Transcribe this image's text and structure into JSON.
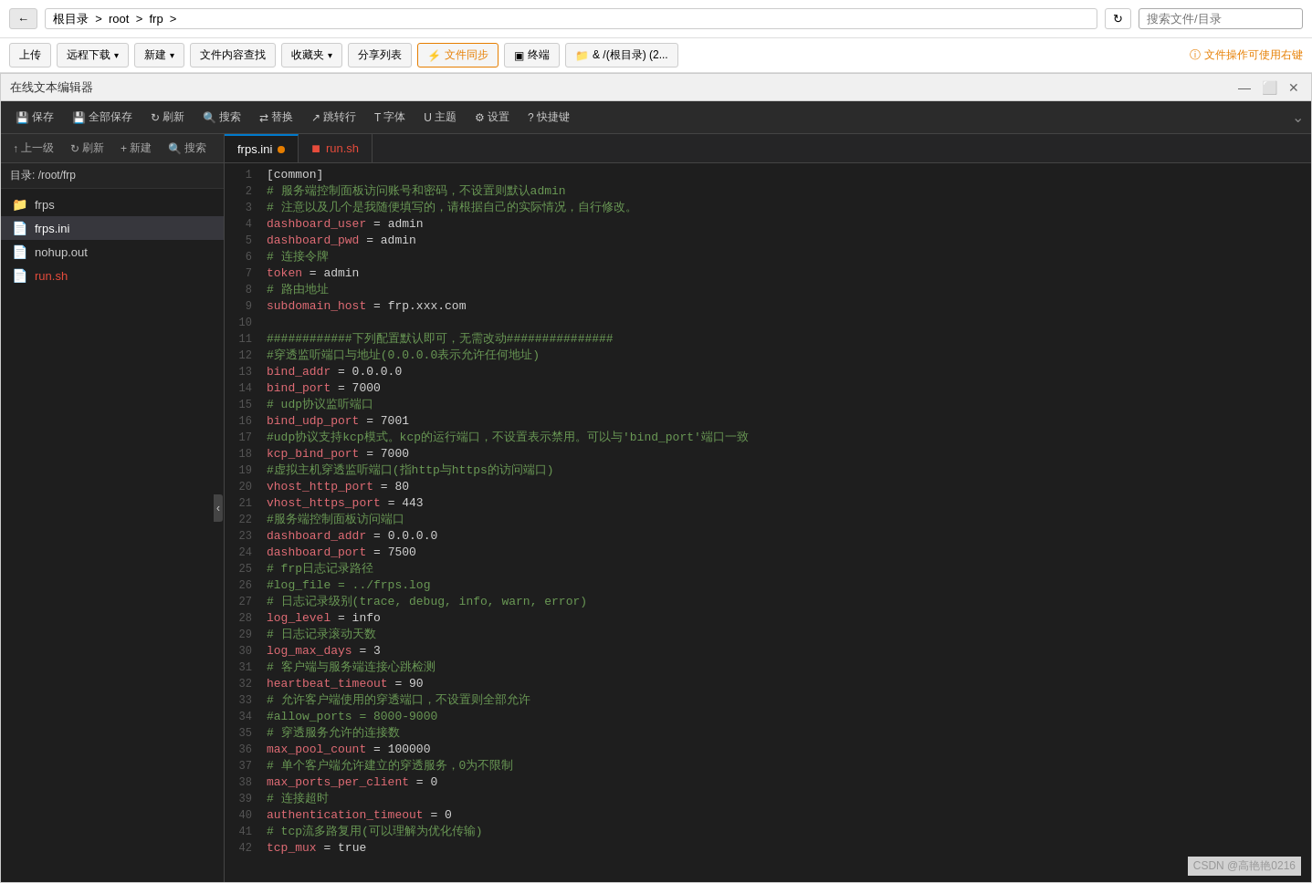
{
  "topnav": {
    "back_label": "←",
    "breadcrumb": "根目录  >  root  >  frp  >",
    "breadcrumb_path": "根目录 > root > frp >",
    "search_placeholder": "搜索文件/目录"
  },
  "toolbar": {
    "upload": "上传",
    "download": "远程下载",
    "new": "新建",
    "search": "文件内容查找",
    "collect": "收藏夹",
    "share": "分享列表",
    "sync": "文件同步",
    "terminal": "终端",
    "dirinfo": "& /(根目录) (2...",
    "right_info": "文件操作可使用右键"
  },
  "editor": {
    "title": "在线文本编辑器",
    "toolbar": {
      "save": "保存",
      "save_all": "全部保存",
      "refresh": "刷新",
      "search": "搜索",
      "replace": "替换",
      "goto": "跳转行",
      "font": "字体",
      "theme": "主题",
      "settings": "设置",
      "shortcut": "快捷键"
    },
    "sidebar": {
      "path_label": "目录: /root/frp",
      "up": "上一级",
      "refresh": "刷新",
      "new": "新建",
      "search": "搜索",
      "files": [
        {
          "name": "frps",
          "type": "folder",
          "active": false
        },
        {
          "name": "frps.ini",
          "type": "ini",
          "active": true
        },
        {
          "name": "nohup.out",
          "type": "file",
          "active": false
        },
        {
          "name": "run.sh",
          "type": "sh",
          "active": false
        }
      ]
    },
    "tabs": [
      {
        "name": "frps.ini",
        "active": true,
        "warning": true
      },
      {
        "name": "run.sh",
        "active": false,
        "sh": true
      }
    ],
    "lines": [
      {
        "num": 1,
        "content": "[common]",
        "type": "section"
      },
      {
        "num": 2,
        "content": "#·服务端控制面板访问账号和密码，不设置则默认admin¤",
        "type": "comment"
      },
      {
        "num": 3,
        "content": "#·注意以及几个是我随便填写的，请根据自己的实际情况，自行修改。¤",
        "type": "comment"
      },
      {
        "num": 4,
        "content": "dashboard_user·=·admin¤",
        "type": "key"
      },
      {
        "num": 5,
        "content": "dashboard_pwd·=·admin¤",
        "type": "key"
      },
      {
        "num": 6,
        "content": "#·连接令牌¤",
        "type": "comment"
      },
      {
        "num": 7,
        "content": "token·=·admin¤",
        "type": "key"
      },
      {
        "num": 8,
        "content": "#·路由地址¤",
        "type": "comment"
      },
      {
        "num": 9,
        "content": "subdomain_host·=·frp.xxx.com¤",
        "type": "key"
      },
      {
        "num": 10,
        "content": "¤",
        "type": "normal"
      },
      {
        "num": 11,
        "content": "############下列配置默认即可，无需改动###############¤",
        "type": "comment"
      },
      {
        "num": 12,
        "content": "#穿透监听端口与地址(0.0.0.0表示允许任何地址)¤",
        "type": "comment"
      },
      {
        "num": 13,
        "content": "bind_addr·=·0.0.0.0¤",
        "type": "key"
      },
      {
        "num": 14,
        "content": "bind_port·=·7000¤",
        "type": "key"
      },
      {
        "num": 15,
        "content": "#·udp协议监听端口¤",
        "type": "comment"
      },
      {
        "num": 16,
        "content": "bind_udp_port·=·7001¤",
        "type": "key"
      },
      {
        "num": 17,
        "content": "#udp协议支持kcp模式。kcp的运行端口，不设置表示禁用。可以与'bind_port'端口一致¤",
        "type": "comment"
      },
      {
        "num": 18,
        "content": "kcp_bind_port·=·7000¤",
        "type": "key"
      },
      {
        "num": 19,
        "content": "#虚拟主机穿透监听端口(指http与https的访问端口)¤",
        "type": "comment"
      },
      {
        "num": 20,
        "content": "vhost_http_port·=·80¤",
        "type": "key"
      },
      {
        "num": 21,
        "content": "vhost_https_port·=·443¤",
        "type": "key"
      },
      {
        "num": 22,
        "content": "#服务端控制面板访问端口¤",
        "type": "comment"
      },
      {
        "num": 23,
        "content": "dashboard_addr·=·0.0.0.0¤",
        "type": "key"
      },
      {
        "num": 24,
        "content": "dashboard_port·=·7500¤",
        "type": "key"
      },
      {
        "num": 25,
        "content": "#·frp日志记录路径¤",
        "type": "comment"
      },
      {
        "num": 26,
        "content": "#log_file·=·../frps.log¤",
        "type": "comment"
      },
      {
        "num": 27,
        "content": "#·日志记录级别(trace,·debug,·info,·warn,·error)¤",
        "type": "comment"
      },
      {
        "num": 28,
        "content": "log_level·=·info¤",
        "type": "key"
      },
      {
        "num": 29,
        "content": "#·日志记录滚动天数¤",
        "type": "comment"
      },
      {
        "num": 30,
        "content": "log_max_days·=·3¤",
        "type": "key"
      },
      {
        "num": 31,
        "content": "#·客户端与服务端连接心跳检测¤",
        "type": "comment"
      },
      {
        "num": 32,
        "content": "heartbeat_timeout·=·90¤",
        "type": "key"
      },
      {
        "num": 33,
        "content": "#·允许客户端使用的穿透端口，不设置则全部允许¤",
        "type": "comment"
      },
      {
        "num": 34,
        "content": "#allow_ports·=·8000-9000¤",
        "type": "comment"
      },
      {
        "num": 35,
        "content": "#·穿透服务允许的连接数¤",
        "type": "comment"
      },
      {
        "num": 36,
        "content": "max_pool_count·=·100000¤",
        "type": "key"
      },
      {
        "num": 37,
        "content": "#·单个客户端允许建立的穿透服务，0为不限制¤",
        "type": "comment"
      },
      {
        "num": 38,
        "content": "max_ports_per_client·=·0¤",
        "type": "key"
      },
      {
        "num": 39,
        "content": "#·连接超时¤",
        "type": "comment"
      },
      {
        "num": 40,
        "content": "authentication_timeout·=·0¤",
        "type": "key"
      },
      {
        "num": 41,
        "content": "#·tcp流多路复用(可以理解为优化传输)·¤",
        "type": "comment"
      },
      {
        "num": 42,
        "content": "tcp_mux·=·true¤",
        "type": "key"
      }
    ]
  },
  "watermark": "CSDN @高艳艳0216"
}
